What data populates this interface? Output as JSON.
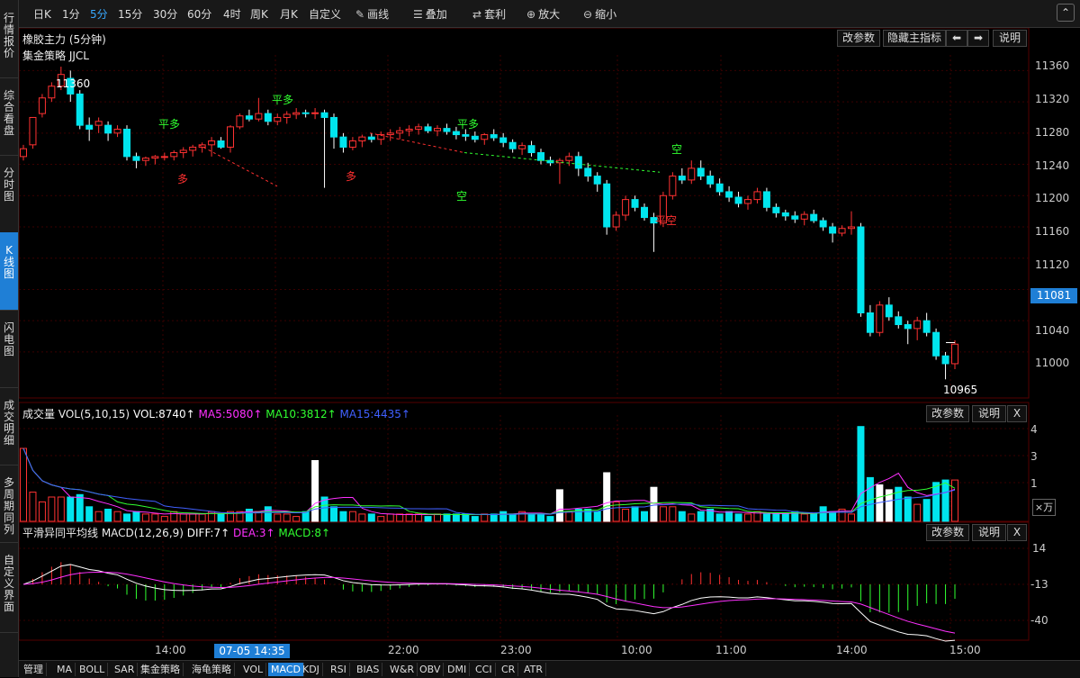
{
  "left_tabs": [
    "行情报价",
    "综合看盘",
    "分时图",
    "K线图",
    "闪电图",
    "成交明细",
    "多周期同列",
    "自定义界面"
  ],
  "toolbar": {
    "periods": [
      "日K",
      "1分",
      "5分",
      "15分",
      "30分",
      "60分",
      "4时",
      "周K",
      "月K",
      "自定义"
    ],
    "active_period": "5分",
    "draw": "画线",
    "overlay": "叠加",
    "arbitrage": "套利",
    "zoom_in": "放大",
    "zoom_out": "缩小"
  },
  "main": {
    "title": "橡胶主力 (5分钟)",
    "strategy": "集金策略 JJCL",
    "buttons": {
      "params": "改参数",
      "hide": "隐藏主指标",
      "explain": "说明"
    },
    "current_price": "11081",
    "high_label": "11360",
    "low_label": "10965",
    "signals": [
      {
        "text": "平多",
        "color": "#30ff30"
      },
      {
        "text": "多",
        "color": "#ff3030"
      },
      {
        "text": "平多",
        "color": "#30ff30"
      },
      {
        "text": "多",
        "color": "#ff3030"
      },
      {
        "text": "平多",
        "color": "#30ff30"
      },
      {
        "text": "空",
        "color": "#30ff30"
      },
      {
        "text": "空",
        "color": "#30ff30"
      },
      {
        "text": "平空",
        "color": "#ff3030"
      }
    ],
    "y_ticks": [
      "11360",
      "11320",
      "11280",
      "11240",
      "11200",
      "11160",
      "11120",
      "11040",
      "11000"
    ]
  },
  "volume": {
    "title": "成交量 VOL(5,10,15)",
    "vol": "VOL:8740↑",
    "ma5": "MA5:5080↑",
    "ma10": "MA10:3812↑",
    "ma15": "MA15:4435↑",
    "buttons": {
      "params": "改参数",
      "explain": "说明",
      "close": "X"
    },
    "y_ticks": [
      "4",
      "3",
      "1"
    ],
    "unit": "×万"
  },
  "macd": {
    "title": "平滑异同平均线 MACD(12,26,9)",
    "diff": "DIFF:7↑",
    "dea": "DEA:3↑",
    "macd": "MACD:8↑",
    "buttons": {
      "params": "改参数",
      "explain": "说明",
      "close": "X"
    },
    "y_ticks": [
      "14",
      "-13",
      "-40"
    ]
  },
  "time_axis": {
    "labels": [
      "14:00",
      "22:00",
      "23:00",
      "10:00",
      "11:00",
      "14:00",
      "15:00"
    ],
    "cursor": "07-05 14:35"
  },
  "bottom_tabs": [
    "管理",
    "MA",
    "BOLL",
    "SAR",
    "集金策略",
    "海龟策略",
    "VOL",
    "MACD",
    "KDJ",
    "RSI",
    "BIAS",
    "W&R",
    "OBV",
    "DMI",
    "CCI",
    "CR",
    "ATR"
  ],
  "colors": {
    "up": "#ff3232",
    "down": "#00e5ee",
    "grid": "#3a0000",
    "active": "#1f7fd6"
  },
  "chart_data": {
    "type": "candlestick",
    "title": "橡胶主力 (5分钟)",
    "ylim": [
      10940,
      11380
    ],
    "ohlc": [
      [
        11250,
        11265,
        11245,
        11260
      ],
      [
        11265,
        11300,
        11260,
        11300
      ],
      [
        11305,
        11330,
        11300,
        11325
      ],
      [
        11325,
        11345,
        11320,
        11340
      ],
      [
        11340,
        11365,
        11335,
        11355
      ],
      [
        11350,
        11360,
        11320,
        11330
      ],
      [
        11330,
        11335,
        11285,
        11290
      ],
      [
        11290,
        11300,
        11270,
        11285
      ],
      [
        11290,
        11300,
        11280,
        11295
      ],
      [
        11290,
        11295,
        11270,
        11280
      ],
      [
        11280,
        11290,
        11275,
        11285
      ],
      [
        11285,
        11290,
        11245,
        11250
      ],
      [
        11250,
        11255,
        11235,
        11245
      ],
      [
        11245,
        11250,
        11238,
        11248
      ],
      [
        11248,
        11252,
        11240,
        11250
      ],
      [
        11250,
        11255,
        11245,
        11250
      ],
      [
        11250,
        11258,
        11245,
        11255
      ],
      [
        11255,
        11262,
        11248,
        11258
      ],
      [
        11258,
        11265,
        11250,
        11262
      ],
      [
        11262,
        11268,
        11255,
        11265
      ],
      [
        11265,
        11275,
        11250,
        11270
      ],
      [
        11270,
        11275,
        11260,
        11262
      ],
      [
        11262,
        11290,
        11255,
        11288
      ],
      [
        11288,
        11305,
        11285,
        11302
      ],
      [
        11302,
        11310,
        11295,
        11298
      ],
      [
        11298,
        11325,
        11295,
        11305
      ],
      [
        11305,
        11310,
        11290,
        11295
      ],
      [
        11295,
        11305,
        11290,
        11300
      ],
      [
        11300,
        11308,
        11292,
        11304
      ],
      [
        11304,
        11312,
        11298,
        11306
      ],
      [
        11306,
        11310,
        11300,
        11305
      ],
      [
        11305,
        11312,
        11298,
        11306
      ],
      [
        11306,
        11310,
        11210,
        11300
      ],
      [
        11300,
        11305,
        11260,
        11275
      ],
      [
        11275,
        11280,
        11255,
        11262
      ],
      [
        11262,
        11275,
        11258,
        11270
      ],
      [
        11270,
        11278,
        11262,
        11275
      ],
      [
        11275,
        11280,
        11268,
        11272
      ],
      [
        11272,
        11282,
        11265,
        11278
      ],
      [
        11278,
        11285,
        11270,
        11280
      ],
      [
        11280,
        11288,
        11272,
        11283
      ],
      [
        11283,
        11290,
        11276,
        11285
      ],
      [
        11285,
        11292,
        11278,
        11288
      ],
      [
        11288,
        11292,
        11280,
        11283
      ],
      [
        11283,
        11290,
        11276,
        11286
      ],
      [
        11286,
        11292,
        11278,
        11282
      ],
      [
        11282,
        11288,
        11272,
        11278
      ],
      [
        11278,
        11285,
        11270,
        11276
      ],
      [
        11276,
        11282,
        11268,
        11272
      ],
      [
        11272,
        11280,
        11265,
        11278
      ],
      [
        11278,
        11285,
        11270,
        11274
      ],
      [
        11274,
        11280,
        11262,
        11268
      ],
      [
        11268,
        11272,
        11255,
        11260
      ],
      [
        11260,
        11268,
        11252,
        11264
      ],
      [
        11264,
        11270,
        11250,
        11255
      ],
      [
        11255,
        11260,
        11240,
        11245
      ],
      [
        11245,
        11250,
        11238,
        11242
      ],
      [
        11242,
        11248,
        11215,
        11245
      ],
      [
        11245,
        11255,
        11238,
        11250
      ],
      [
        11250,
        11256,
        11225,
        11235
      ],
      [
        11235,
        11242,
        11218,
        11225
      ],
      [
        11225,
        11230,
        11205,
        11215
      ],
      [
        11215,
        11220,
        11150,
        11160
      ],
      [
        11160,
        11180,
        11155,
        11175
      ],
      [
        11175,
        11200,
        11168,
        11195
      ],
      [
        11195,
        11200,
        11180,
        11185
      ],
      [
        11185,
        11190,
        11168,
        11172
      ],
      [
        11172,
        11178,
        11128,
        11165
      ],
      [
        11165,
        11205,
        11160,
        11200
      ],
      [
        11200,
        11230,
        11195,
        11225
      ],
      [
        11225,
        11235,
        11215,
        11220
      ],
      [
        11220,
        11245,
        11215,
        11235
      ],
      [
        11235,
        11245,
        11220,
        11225
      ],
      [
        11225,
        11232,
        11210,
        11215
      ],
      [
        11215,
        11222,
        11200,
        11205
      ],
      [
        11205,
        11212,
        11192,
        11198
      ],
      [
        11198,
        11205,
        11185,
        11190
      ],
      [
        11190,
        11200,
        11182,
        11195
      ],
      [
        11195,
        11210,
        11190,
        11205
      ],
      [
        11205,
        11210,
        11180,
        11185
      ],
      [
        11185,
        11190,
        11172,
        11178
      ],
      [
        11178,
        11182,
        11168,
        11174
      ],
      [
        11174,
        11180,
        11165,
        11170
      ],
      [
        11170,
        11180,
        11162,
        11176
      ],
      [
        11176,
        11182,
        11165,
        11168
      ],
      [
        11168,
        11172,
        11155,
        11160
      ],
      [
        11160,
        11165,
        11140,
        11152
      ],
      [
        11152,
        11162,
        11148,
        11158
      ],
      [
        11158,
        11180,
        11150,
        11160
      ],
      [
        11160,
        11165,
        11045,
        11050
      ],
      [
        11050,
        11060,
        11020,
        11025
      ],
      [
        11025,
        11065,
        11020,
        11060
      ],
      [
        11060,
        11070,
        11040,
        11045
      ],
      [
        11045,
        11052,
        11030,
        11035
      ],
      [
        11035,
        11040,
        11010,
        11030
      ],
      [
        11030,
        11045,
        11015,
        11040
      ],
      [
        11040,
        11050,
        11020,
        11025
      ],
      [
        11025,
        11030,
        10990,
        10995
      ],
      [
        10995,
        11000,
        10965,
        10985
      ],
      [
        10985,
        11015,
        10978,
        11010
      ]
    ],
    "volume": [
      3.0,
      1.2,
      0.8,
      1.0,
      1.0,
      1.0,
      1.1,
      0.6,
      0.4,
      0.5,
      0.4,
      0.3,
      0.4,
      0.3,
      0.3,
      0.2,
      0.4,
      0.3,
      0.3,
      0.3,
      0.4,
      0.3,
      0.4,
      0.4,
      0.5,
      0.4,
      0.6,
      0.3,
      0.3,
      0.2,
      0.4,
      2.5,
      1.0,
      0.6,
      0.4,
      0.4,
      0.3,
      0.3,
      0.2,
      0.3,
      0.3,
      0.3,
      0.3,
      0.2,
      0.3,
      0.3,
      0.3,
      0.3,
      0.2,
      0.3,
      0.3,
      0.4,
      0.3,
      0.4,
      0.3,
      0.3,
      0.2,
      1.3,
      0.4,
      0.5,
      0.5,
      0.4,
      2.0,
      0.8,
      0.5,
      0.6,
      0.4,
      1.4,
      0.6,
      0.6,
      0.4,
      0.3,
      0.4,
      0.5,
      0.3,
      0.4,
      0.3,
      0.3,
      0.4,
      0.3,
      0.3,
      0.3,
      0.4,
      0.3,
      0.3,
      0.6,
      0.4,
      0.5,
      0.3,
      3.9,
      1.8,
      1.5,
      1.3,
      1.4,
      1.0,
      0.7,
      0.9,
      1.6,
      1.7,
      1.7
    ]
  }
}
